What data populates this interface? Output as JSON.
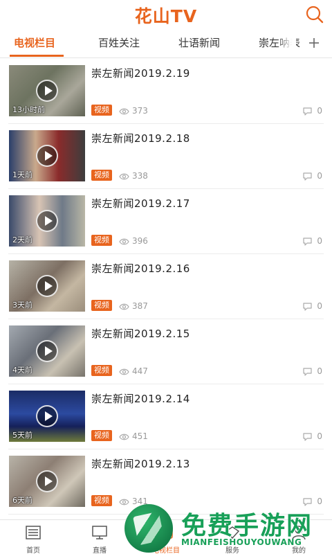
{
  "header": {
    "logo_text": "花山TV"
  },
  "tabs": [
    {
      "label": "电视栏目",
      "active": true
    },
    {
      "label": "百姓关注",
      "active": false
    },
    {
      "label": "壮语新闻",
      "active": false
    },
    {
      "label": "崇左呐表",
      "active": false
    }
  ],
  "badge_label": "视频",
  "items": [
    {
      "title": "崇左新闻2019.2.19",
      "ago": "13小时前",
      "views": "373",
      "comments": "0"
    },
    {
      "title": "崇左新闻2019.2.18",
      "ago": "1天前",
      "views": "338",
      "comments": "0"
    },
    {
      "title": "崇左新闻2019.2.17",
      "ago": "2天前",
      "views": "396",
      "comments": "0"
    },
    {
      "title": "崇左新闻2019.2.16",
      "ago": "3天前",
      "views": "387",
      "comments": "0"
    },
    {
      "title": "崇左新闻2019.2.15",
      "ago": "4天前",
      "views": "447",
      "comments": "0"
    },
    {
      "title": "崇左新闻2019.2.14",
      "ago": "5天前",
      "views": "451",
      "comments": "0"
    },
    {
      "title": "崇左新闻2019.2.13",
      "ago": "6天前",
      "views": "341",
      "comments": "0"
    }
  ],
  "bottom_nav": [
    {
      "label": "首页",
      "icon": "news-icon",
      "active": false
    },
    {
      "label": "直播",
      "icon": "tv-icon",
      "active": false
    },
    {
      "label": "电视栏目",
      "icon": "program-icon",
      "active": true
    },
    {
      "label": "服务",
      "icon": "service-icon",
      "active": false
    },
    {
      "label": "我的",
      "icon": "user-icon",
      "active": false
    }
  ],
  "watermark": {
    "title": "免费手游网",
    "subtitle": "MIANFEISHOUYOUWANG"
  },
  "colors": {
    "accent": "#e8641e",
    "watermark": "#18a058"
  }
}
